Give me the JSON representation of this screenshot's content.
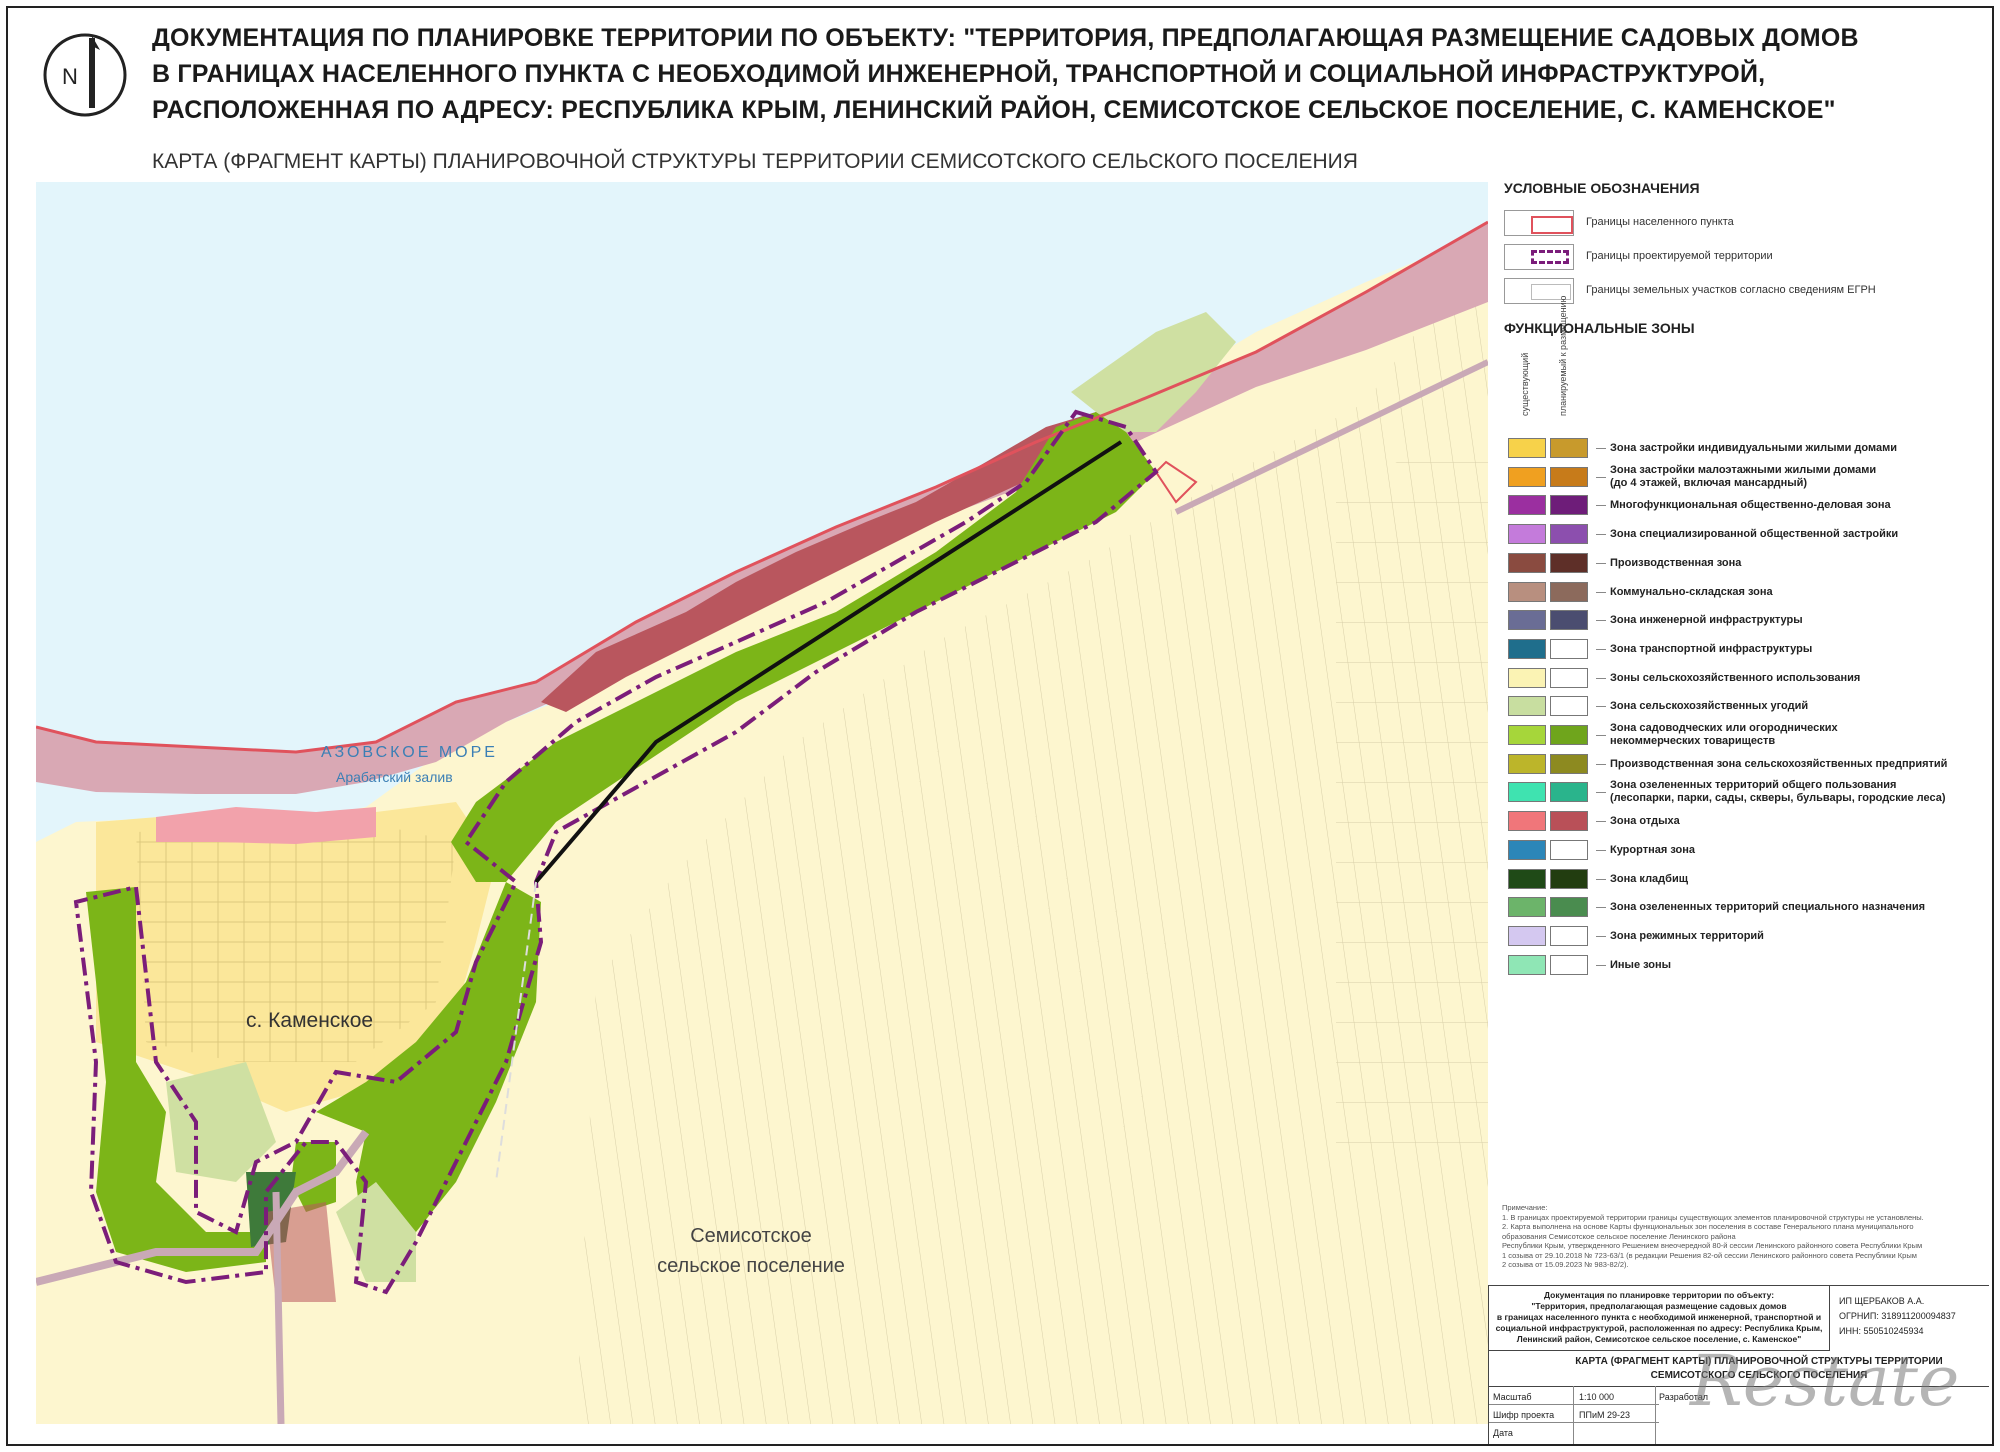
{
  "title": {
    "line1": "ДОКУМЕНТАЦИЯ ПО ПЛАНИРОВКЕ ТЕРРИТОРИИ ПО ОБЪЕКТУ: \"ТЕРРИТОРИЯ, ПРЕДПОЛАГАЮЩАЯ РАЗМЕЩЕНИЕ САДОВЫХ ДОМОВ",
    "line2": "В ГРАНИЦАХ НАСЕЛЕННОГО ПУНКТА С НЕОБХОДИМОЙ ИНЖЕНЕРНОЙ, ТРАНСПОРТНОЙ И СОЦИАЛЬНОЙ ИНФРАСТРУКТУРОЙ,",
    "line3": "РАСПОЛОЖЕННАЯ ПО АДРЕСУ: РЕСПУБЛИКА КРЫМ, ЛЕНИНСКИЙ РАЙОН, СЕМИСОТСКОЕ СЕЛЬСКОЕ ПОСЕЛЕНИЕ, С. КАМЕНСКОЕ\"",
    "subtitle": "КАРТА (ФРАГМЕНТ КАРТЫ) ПЛАНИРОВОЧНОЙ СТРУКТУРЫ ТЕРРИТОРИИ СЕМИСОТСКОГО СЕЛЬСКОГО ПОСЕЛЕНИЯ"
  },
  "north_arrow": {
    "letter": "N",
    "icon": "north-arrow-icon"
  },
  "map": {
    "sea_name": "АЗОВСКОЕ МОРЕ",
    "bay_name": "Арабатский залив",
    "village_name": "с. Каменское",
    "settlement_line1": "Семисотское",
    "settlement_line2": "сельское поселение",
    "colors": {
      "sea": "#e3f5fb",
      "coast": "#d9a8b4",
      "settlement": "#fbe79a",
      "garden": "#7cb518",
      "production": "#b9565e",
      "agri": "#fdf6cf",
      "agri_land": "#cfe0a2",
      "recreation": "#f2a2ab",
      "boundary": "#e0525c",
      "project_boundary": "#7b1d7a",
      "road": "#c9a9b6"
    }
  },
  "legend": {
    "title": "УСЛОВНЫЕ ОБОЗНАЧЕНИЯ",
    "boundaries": [
      {
        "label": "Границы населенного пункта",
        "style": "solid-red"
      },
      {
        "label": "Границы проектируемой территории",
        "style": "dashed-purple"
      },
      {
        "label": "Границы земельных участков согласно сведениям ЕГРН",
        "style": "thin-grey"
      }
    ],
    "zones_title": "ФУНКЦИОНАЛЬНЫЕ ЗОНЫ",
    "col1": "существующий",
    "col2": "планируемый к размещению",
    "zones": [
      {
        "line1": "Зона застройки индивидуальными жилыми домами",
        "line2": "",
        "c1": "#f7d24a",
        "c2": "#c89a2c"
      },
      {
        "line1": "Зона застройки малоэтажными жилыми домами",
        "line2": "(до 4 этажей, включая мансардный)",
        "c1": "#f0a020",
        "c2": "#c77b1a"
      },
      {
        "line1": "Многофункциональная общественно-деловая зона",
        "line2": "",
        "c1": "#9b2fa0",
        "c2": "#6e1d79"
      },
      {
        "line1": "Зона специализированной общественной застройки",
        "line2": "",
        "c1": "#c47bdb",
        "c2": "#8c4fae"
      },
      {
        "line1": "Производственная зона",
        "line2": "",
        "c1": "#8a4b40",
        "c2": "#5e2f28"
      },
      {
        "line1": "Коммунально-складская зона",
        "line2": "",
        "c1": "#b88f7f",
        "c2": "#8c6a5c"
      },
      {
        "line1": "Зона инженерной инфраструктуры",
        "line2": "",
        "c1": "#6a6d95",
        "c2": "#4b4d70"
      },
      {
        "line1": "Зона транспортной инфраструктуры",
        "line2": "",
        "c1": "#1f6e8c",
        "c2": "#ffffff"
      },
      {
        "line1": "Зоны сельскохозяйственного использования",
        "line2": "",
        "c1": "#fbf3b4",
        "c2": "#ffffff"
      },
      {
        "line1": "Зона сельскохозяйственных угодий",
        "line2": "",
        "c1": "#c8dea0",
        "c2": "#ffffff"
      },
      {
        "line1": "Зона садоводческих или огороднических",
        "line2": "некоммерческих товариществ",
        "c1": "#a6d63a",
        "c2": "#6fa51c"
      },
      {
        "line1": "Производственная зона сельскохозяйственных предприятий",
        "line2": "",
        "c1": "#bcb52a",
        "c2": "#8d8a20"
      },
      {
        "line1": "Зона озелененных территорий общего пользования",
        "line2": "(лесопарки, парки, сады, скверы, бульвары, городские леса)",
        "c1": "#3fe3b0",
        "c2": "#2ab48c"
      },
      {
        "line1": "Зона отдыха",
        "line2": "",
        "c1": "#f0767a",
        "c2": "#b95058"
      },
      {
        "line1": "Курортная зона",
        "line2": "",
        "c1": "#2c86b8",
        "c2": "#ffffff"
      },
      {
        "line1": "Зона кладбищ",
        "line2": "",
        "c1": "#1f4a17",
        "c2": "#223d10"
      },
      {
        "line1": "Зона озелененных территорий специального назначения",
        "line2": "",
        "c1": "#6cb46a",
        "c2": "#4a8c4f"
      },
      {
        "line1": "Зона режимных территорий",
        "line2": "",
        "c1": "#d4c8f0",
        "c2": "#ffffff"
      },
      {
        "line1": "Иные зоны",
        "line2": "",
        "c1": "#8fe6b5",
        "c2": "#ffffff"
      }
    ]
  },
  "notes": {
    "heading": "Примечание:",
    "line1": "1. В границах проектируемой территории границы существующих элементов планировочной структуры не установлены.",
    "line2": "2. Карта выполнена на основе Карты функциональных зон поселения в составе Генерального плана муниципального",
    "line3": "образования Семисотское сельское поселение Ленинского района",
    "line4": "Республики Крым, утвержденного Решением внеочередной 80-й сессии Ленинского районного совета Республики Крым",
    "line5": "1 созыва от 29.10.2018 № 723-63/1 (в редакции Решения 82-ой сессии Ленинского районного совета Республики Крым",
    "line6": "2 созыва от 15.09.2023 № 983-82/2)."
  },
  "stamp": {
    "doc_line1": "Документация по планировке территории по объекту:",
    "doc_line2": "\"Территория, предполагающая размещение садовых домов",
    "doc_line3": "в границах населенного пункта с необходимой инженерной, транспортной и",
    "doc_line4": "социальной инфраструктурой, расположенная по адресу: Республика Крым,",
    "doc_line5": "Ленинский район, Семисотское сельское поселение, с. Каменское\"",
    "org1": "ИП ЩЕРБАКОВ А.А.",
    "org2": "ОГРНИП: 318911200094837",
    "org3": "ИНН: 550510245934",
    "sheet_line1": "КАРТА (ФРАГМЕНТ КАРТЫ) ПЛАНИРОВОЧНОЙ СТРУКТУРЫ ТЕРРИТОРИИ",
    "sheet_line2": "СЕМИСОТСКОГО СЕЛЬСКОГО ПОСЕЛЕНИЯ",
    "scale_label": "Масштаб",
    "scale_value": "1:10 000",
    "cipher_label": "Шифр проекта",
    "cipher_value": "ППиМ 29-23",
    "date_label": "Дата",
    "dev_label": "Разработал"
  },
  "watermark": "Restate"
}
